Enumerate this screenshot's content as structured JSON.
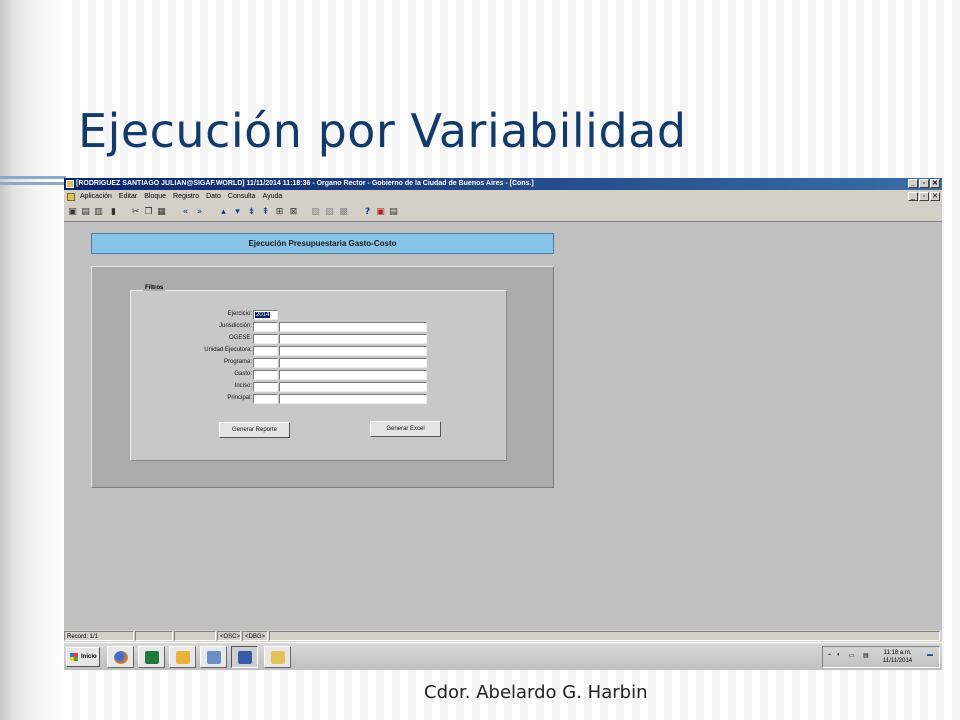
{
  "slide": {
    "title": "Ejecución por Variabilidad",
    "footer": "Cdor. Abelardo G. Harbin"
  },
  "window": {
    "title": "[RODRIGUEZ SANTIAGO JULIAN@SIGAF.WORLD]  11/11/2014 11:18:36 - Organo Rector - Gobierno de la Ciudad de Buenos Aires - [Cons.]",
    "controls": [
      "_",
      "▫",
      "✕"
    ]
  },
  "menubar": {
    "items": [
      "Aplicación",
      "Editar",
      "Bloque",
      "Registro",
      "Dato",
      "Consulta",
      "Ayuda"
    ]
  },
  "form": {
    "header": "Ejecución Presupuestaria Gasto-Costo",
    "group_label": "Filtros",
    "fields": [
      {
        "label": "Ejercicio:",
        "value": "2014"
      },
      {
        "label": "Jurisdicción:",
        "value": ""
      },
      {
        "label": "OGESE:",
        "value": ""
      },
      {
        "label": "Unidad Ejecutora:",
        "value": ""
      },
      {
        "label": "Programa:",
        "value": ""
      },
      {
        "label": "Gasto:",
        "value": ""
      },
      {
        "label": "Inciso:",
        "value": ""
      },
      {
        "label": "Principal:",
        "value": ""
      }
    ],
    "buttons": {
      "report": "Generar Reporte",
      "excel": "Generar Excel"
    }
  },
  "statusbar": {
    "record": "Record: 1/1",
    "osc": "<OSC>",
    "dbg": "<DBG>"
  },
  "taskbar": {
    "start": "Inicio",
    "time": "11:18 a.m.",
    "date": "11/11/2014"
  }
}
